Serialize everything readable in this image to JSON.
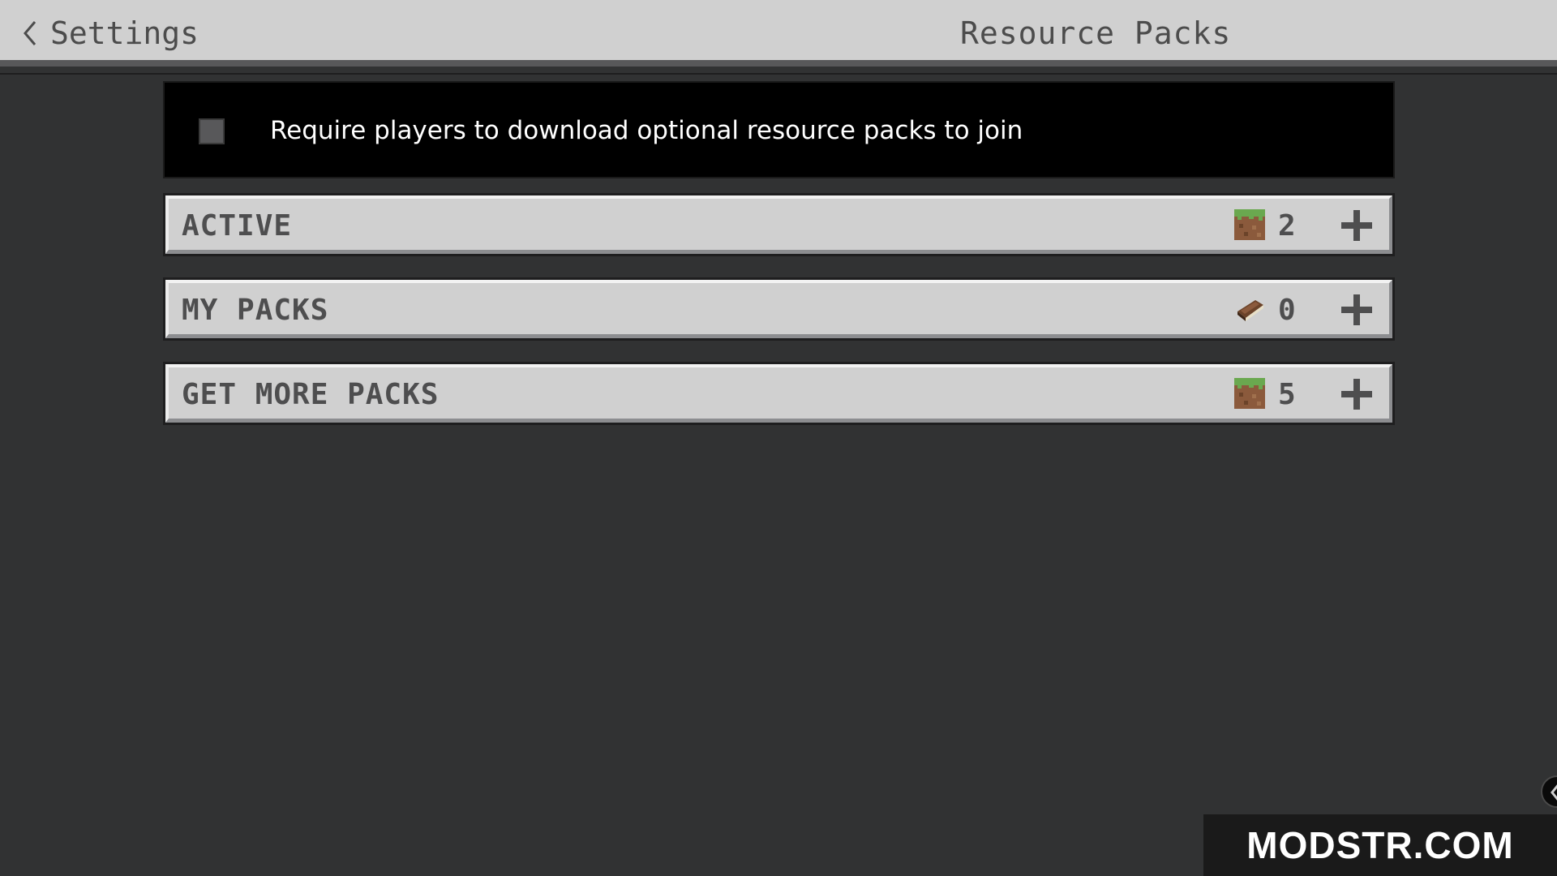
{
  "header": {
    "back_label": "Settings",
    "title": "Resource Packs"
  },
  "require_panel": {
    "checked": false,
    "label": "Require players to download optional resource packs to join"
  },
  "sections": [
    {
      "title": "ACTIVE",
      "count": "2",
      "icon": "grass-block-icon"
    },
    {
      "title": "MY PACKS",
      "count": "0",
      "icon": "book-icon"
    },
    {
      "title": "GET MORE PACKS",
      "count": "5",
      "icon": "grass-block-icon"
    }
  ],
  "watermark": "MODSTR.COM",
  "colors": {
    "background": "#313233",
    "header": "#d0d0d0",
    "row": "#d0d0d0",
    "row_text": "#4e4e4f"
  }
}
